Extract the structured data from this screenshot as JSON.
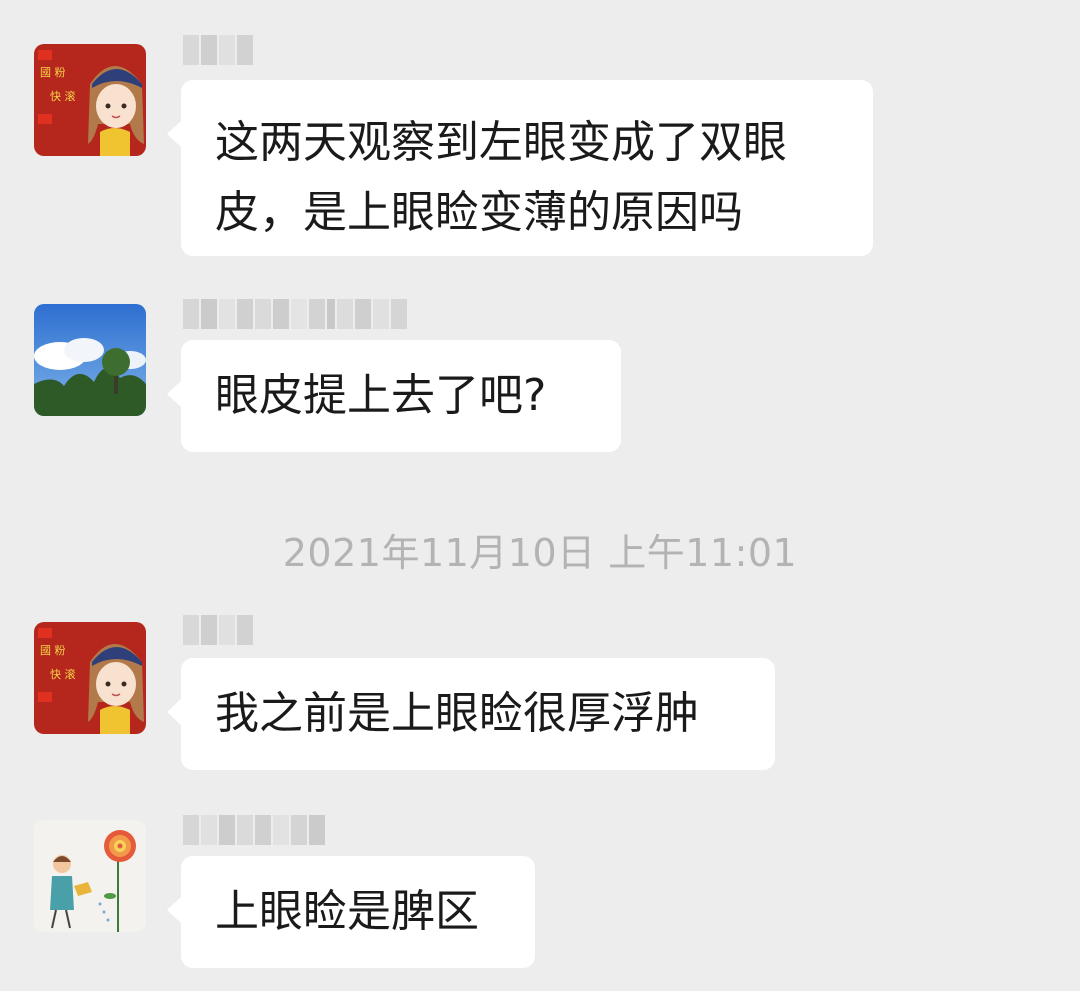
{
  "chat": {
    "messages": [
      {
        "avatar_icon": "girl-cartoon-red-avatar-icon",
        "avatar_text": [
          "國 粉",
          "快 滚"
        ],
        "text": "这两天观察到左眼变成了双眼皮，是上眼睑变薄的原因吗"
      },
      {
        "avatar_icon": "sky-trees-landscape-avatar-icon",
        "text": "眼皮提上去了吧?"
      },
      {
        "avatar_icon": "girl-cartoon-red-avatar-icon",
        "avatar_text": [
          "國 粉",
          "快 滚"
        ],
        "text": "我之前是上眼睑很厚浮肿"
      },
      {
        "avatar_icon": "boy-watering-flower-avatar-icon",
        "text": "上眼睑是脾区"
      }
    ],
    "timestamp": "2021年11月10日 上午11:01"
  },
  "colors": {
    "background": "#ededed",
    "bubble": "#ffffff",
    "timestamp_text": "#b3b3b3",
    "avatar_red": "#b5271c"
  }
}
